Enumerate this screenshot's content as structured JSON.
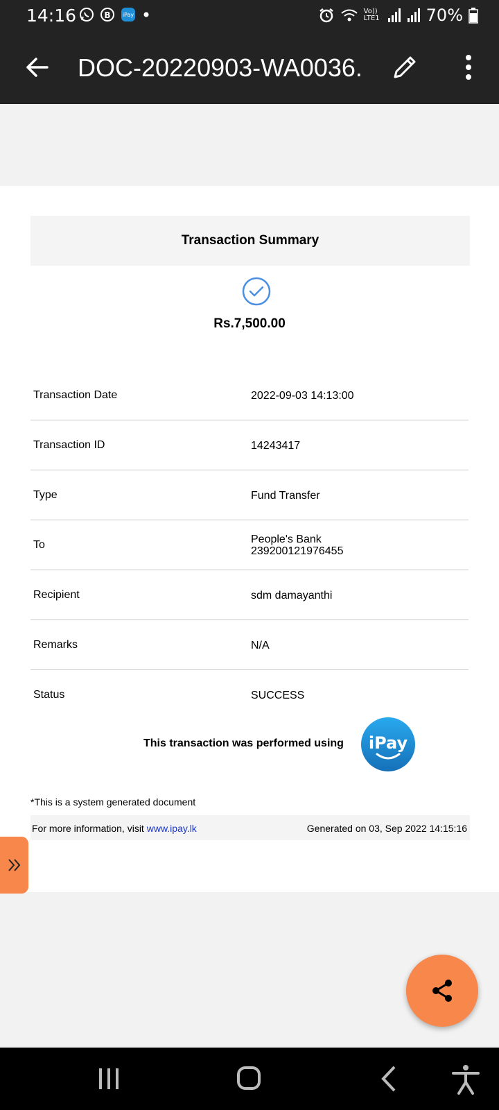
{
  "status_bar": {
    "time": "14:16",
    "battery_percent": "70%",
    "network_label": "Vo)) LTE1",
    "icons_left": [
      "whatsapp-icon",
      "business-icon",
      "ipay-icon",
      "dot-icon"
    ],
    "icons_right": [
      "alarm-icon",
      "wifi-icon",
      "signal-icon",
      "signal-icon",
      "battery-icon"
    ]
  },
  "app_bar": {
    "title": "DOC-20220903-WA0036.",
    "back_icon": "arrow-back-icon",
    "edit_icon": "pencil-icon",
    "more_icon": "more-vert-icon"
  },
  "document": {
    "heading": "Transaction Summary",
    "amount": "Rs.7,500.00",
    "rows": [
      {
        "label": "Transaction Date",
        "value": "2022-09-03 14:13:00",
        "value2": ""
      },
      {
        "label": "Transaction ID",
        "value": "14243417",
        "value2": ""
      },
      {
        "label": "Type",
        "value": "Fund Transfer",
        "value2": ""
      },
      {
        "label": "To",
        "value": "People's Bank",
        "value2": "239200121976455"
      },
      {
        "label": "Recipient",
        "value": "sdm damayanthi",
        "value2": ""
      },
      {
        "label": "Remarks",
        "value": "N/A",
        "value2": ""
      },
      {
        "label": "Status",
        "value": "SUCCESS",
        "value2": ""
      }
    ],
    "performed_text": "This transaction was performed using",
    "logo_text": "iPay",
    "system_note": "*This is a system generated document",
    "info_prefix": "For more information, visit ",
    "info_link": "www.ipay.lk",
    "generated": "Generated on 03, Sep 2022 14:15:16"
  },
  "colors": {
    "accent": "#f7874a",
    "bar": "#232323",
    "link": "#1a37c4",
    "check": "#4a90e2",
    "logo": "#1e8ed8"
  }
}
